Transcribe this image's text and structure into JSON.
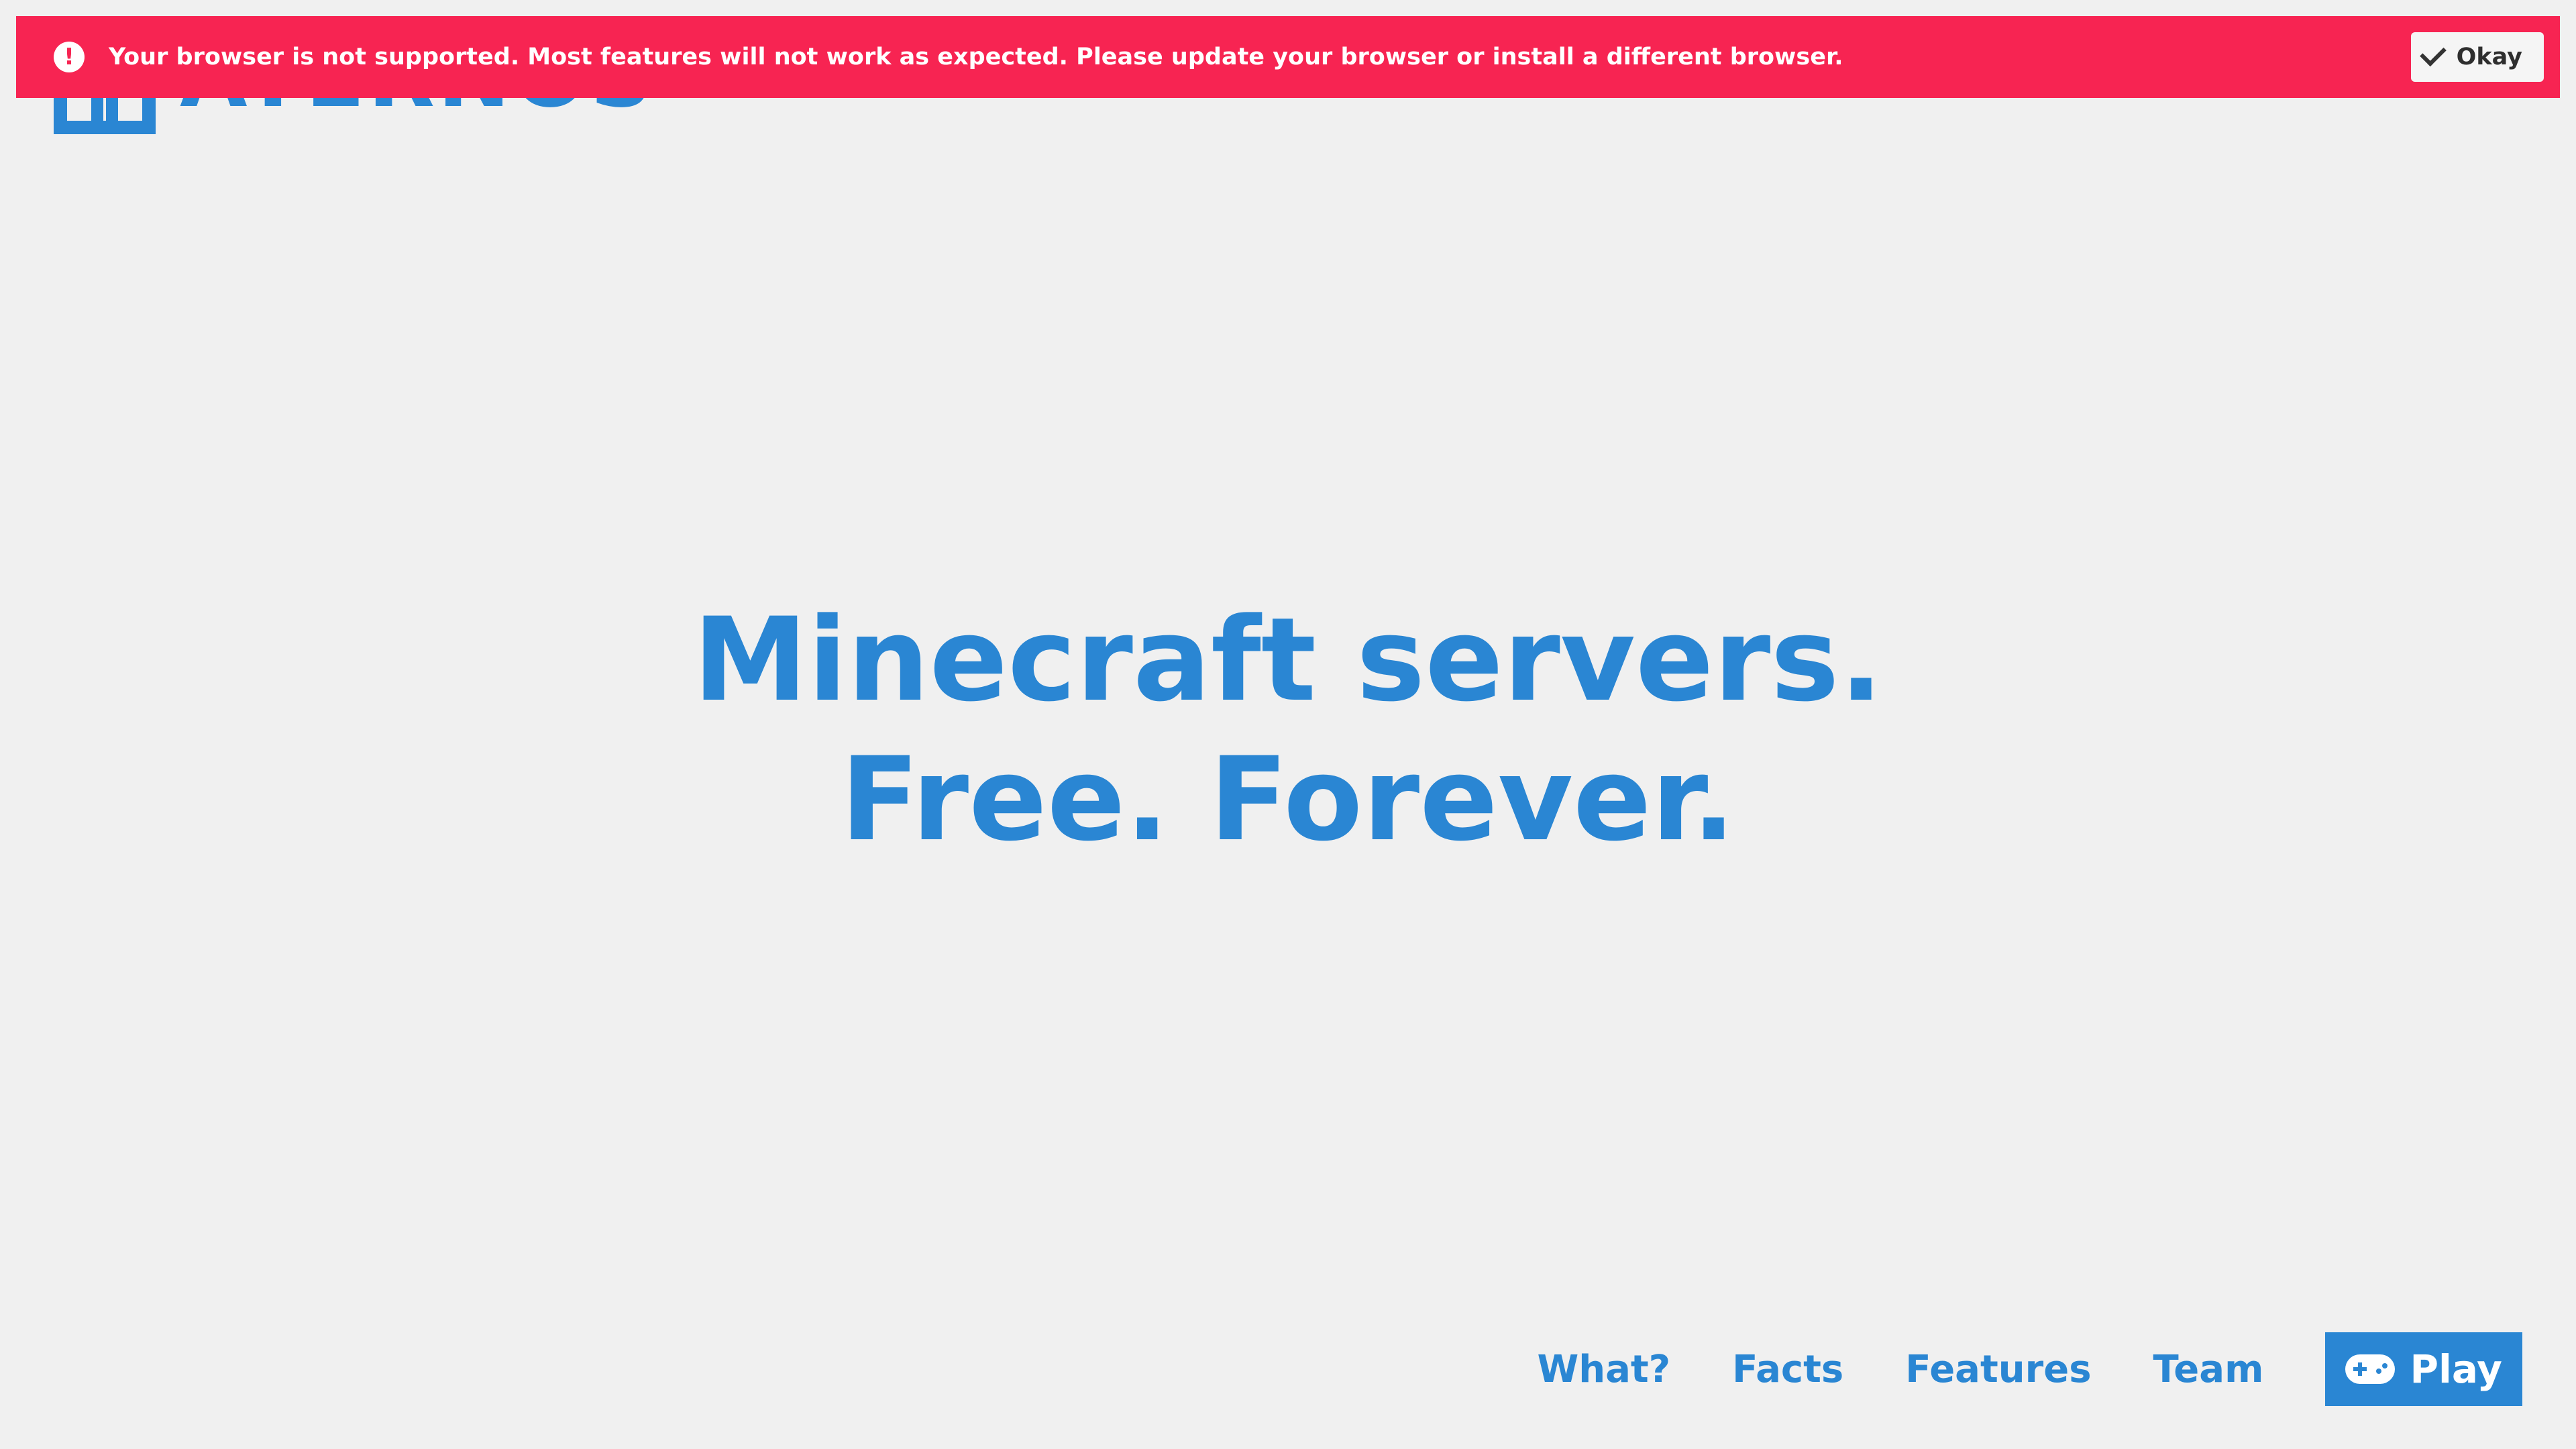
{
  "logo": {
    "text": "ATERNOS"
  },
  "banner": {
    "icon": "exclamation-icon",
    "icon_glyph": "!",
    "message": "Your browser is not supported. Most features will not work as expected. Please update your browser or install a different browser.",
    "okay_label": "Okay",
    "background_color": "#f72452"
  },
  "hero": {
    "line1": "Minecraft servers.",
    "line2": "Free. Forever."
  },
  "nav": {
    "items": [
      {
        "label": "What?"
      },
      {
        "label": "Facts"
      },
      {
        "label": "Features"
      },
      {
        "label": "Team"
      }
    ],
    "play_label": "Play",
    "play_icon": "gamepad-icon"
  },
  "colors": {
    "accent": "#2a86d3",
    "background": "#f0f0f0"
  }
}
